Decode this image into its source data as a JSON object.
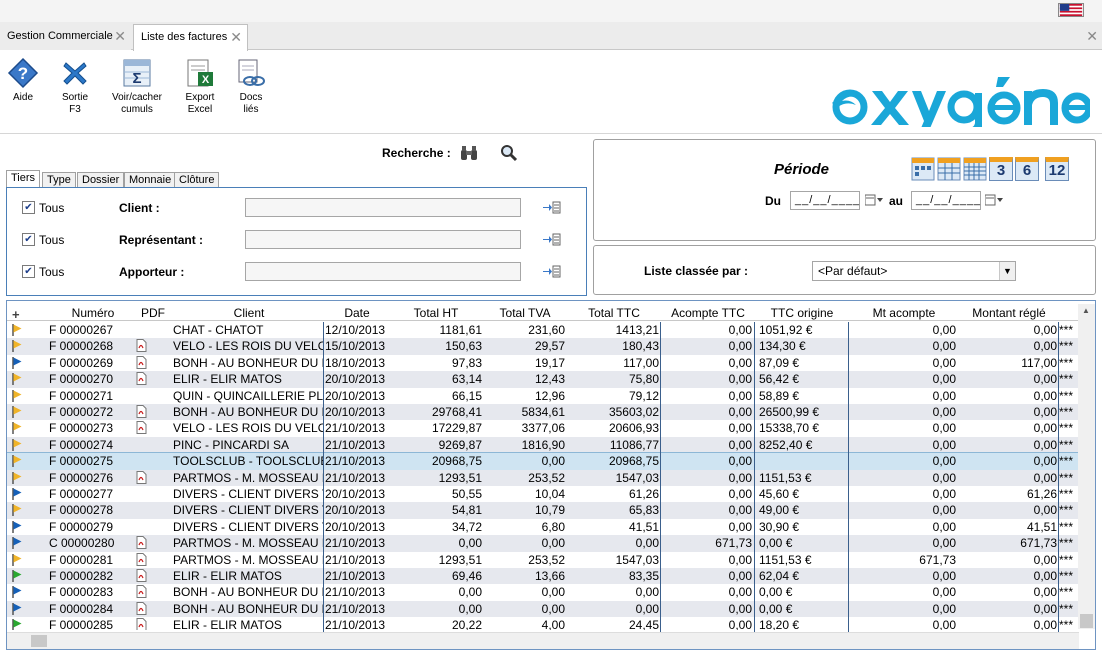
{
  "tabs": [
    {
      "label": "Gestion Commerciale"
    },
    {
      "label": "Liste des factures"
    }
  ],
  "toolbar": {
    "aide": "Aide",
    "sortie": "Sortie\nF3",
    "cumuls": "Voir/cacher\ncumuls",
    "export": "Export\nExcel",
    "docs": "Docs\nliés"
  },
  "search": {
    "label": "Recherche :"
  },
  "subtabs": [
    "Tiers",
    "Type",
    "Dossier",
    "Monnaie",
    "Clôture"
  ],
  "filters": [
    {
      "check": "Tous",
      "label": "Client :",
      "value": ""
    },
    {
      "check": "Tous",
      "label": "Représentant :",
      "value": ""
    },
    {
      "check": "Tous",
      "label": "Apporteur :",
      "value": ""
    }
  ],
  "periode": {
    "title": "Période",
    "du": "Du",
    "au": "au",
    "date_from": "__/__/____",
    "date_to": "__/__/____",
    "btn_3": "3",
    "btn_6": "6",
    "btn_12": "12"
  },
  "sort": {
    "label": "Liste classée par :",
    "value": "<Par défaut>"
  },
  "grid": {
    "headers": [
      "Numéro",
      "PDF",
      "Client",
      "Date",
      "Total HT",
      "Total TVA",
      "Total TTC",
      "Acompte TTC",
      "TTC origine",
      "Mt acompte",
      "Montant réglé"
    ],
    "rows": [
      {
        "flag": "orange",
        "pdf": false,
        "num": "F 00000267",
        "client": "CHAT - CHATOT",
        "date": "12/10/2013",
        "ht": "1181,61",
        "tva": "231,60",
        "ttc": "1413,21",
        "acompte": "0,00",
        "origine": "1051,92 €",
        "mt": "0,00",
        "regle": "0,00",
        "flagx": "***"
      },
      {
        "flag": "orange",
        "pdf": true,
        "num": "F 00000268",
        "client": "VELO - LES ROIS DU VELO",
        "date": "15/10/2013",
        "ht": "150,63",
        "tva": "29,57",
        "ttc": "180,43",
        "acompte": "0,00",
        "origine": "134,30 €",
        "mt": "0,00",
        "regle": "0,00",
        "flagx": "***"
      },
      {
        "flag": "blue",
        "pdf": true,
        "num": "F 00000269",
        "client": "BONH - AU BONHEUR DU B",
        "date": "18/10/2013",
        "ht": "97,83",
        "tva": "19,17",
        "ttc": "117,00",
        "acompte": "0,00",
        "origine": "87,09 €",
        "mt": "0,00",
        "regle": "117,00",
        "flagx": "***"
      },
      {
        "flag": "orange",
        "pdf": true,
        "num": "F 00000270",
        "client": "ELIR - ELIR MATOS",
        "date": "20/10/2013",
        "ht": "63,14",
        "tva": "12,43",
        "ttc": "75,80",
        "acompte": "0,00",
        "origine": "56,42 €",
        "mt": "0,00",
        "regle": "0,00",
        "flagx": "***"
      },
      {
        "flag": "orange",
        "pdf": false,
        "num": "F 00000271",
        "client": "QUIN - QUINCAILLERIE PL",
        "date": "20/10/2013",
        "ht": "66,15",
        "tva": "12,96",
        "ttc": "79,12",
        "acompte": "0,00",
        "origine": "58,89 €",
        "mt": "0,00",
        "regle": "0,00",
        "flagx": "***"
      },
      {
        "flag": "orange",
        "pdf": true,
        "num": "F 00000272",
        "client": "BONH - AU BONHEUR DU B",
        "date": "20/10/2013",
        "ht": "29768,41",
        "tva": "5834,61",
        "ttc": "35603,02",
        "acompte": "0,00",
        "origine": "26500,99 €",
        "mt": "0,00",
        "regle": "0,00",
        "flagx": "***"
      },
      {
        "flag": "orange",
        "pdf": true,
        "num": "F 00000273",
        "client": "VELO - LES ROIS DU VELO",
        "date": "21/10/2013",
        "ht": "17229,87",
        "tva": "3377,06",
        "ttc": "20606,93",
        "acompte": "0,00",
        "origine": "15338,70 €",
        "mt": "0,00",
        "regle": "0,00",
        "flagx": "***"
      },
      {
        "flag": "orange",
        "pdf": false,
        "num": "F 00000274",
        "client": "PINC - PINCARDI SA",
        "date": "21/10/2013",
        "ht": "9269,87",
        "tva": "1816,90",
        "ttc": "11086,77",
        "acompte": "0,00",
        "origine": "8252,40 €",
        "mt": "0,00",
        "regle": "0,00",
        "flagx": "***"
      },
      {
        "flag": "orange",
        "pdf": false,
        "num": "F 00000275",
        "client": "TOOLSCLUB - TOOLSCLUB",
        "date": "21/10/2013",
        "ht": "20968,75",
        "tva": "0,00",
        "ttc": "20968,75",
        "acompte": "0,00",
        "origine": "",
        "mt": "0,00",
        "regle": "0,00",
        "flagx": "***",
        "selected": true
      },
      {
        "flag": "orange",
        "pdf": true,
        "num": "F 00000276",
        "client": "PARTMOS - M. MOSSEAU E",
        "date": "21/10/2013",
        "ht": "1293,51",
        "tva": "253,52",
        "ttc": "1547,03",
        "acompte": "0,00",
        "origine": "1151,53 €",
        "mt": "0,00",
        "regle": "0,00",
        "flagx": "***"
      },
      {
        "flag": "blue",
        "pdf": false,
        "num": "F 00000277",
        "client": "DIVERS - CLIENT DIVERS T",
        "date": "20/10/2013",
        "ht": "50,55",
        "tva": "10,04",
        "ttc": "61,26",
        "acompte": "0,00",
        "origine": "45,60 €",
        "mt": "0,00",
        "regle": "61,26",
        "flagx": "***"
      },
      {
        "flag": "orange",
        "pdf": false,
        "num": "F 00000278",
        "client": "DIVERS - CLIENT DIVERS T",
        "date": "20/10/2013",
        "ht": "54,81",
        "tva": "10,79",
        "ttc": "65,83",
        "acompte": "0,00",
        "origine": "49,00 €",
        "mt": "0,00",
        "regle": "0,00",
        "flagx": "***"
      },
      {
        "flag": "blue",
        "pdf": false,
        "num": "F 00000279",
        "client": "DIVERS - CLIENT DIVERS T",
        "date": "20/10/2013",
        "ht": "34,72",
        "tva": "6,80",
        "ttc": "41,51",
        "acompte": "0,00",
        "origine": "30,90 €",
        "mt": "0,00",
        "regle": "41,51",
        "flagx": "***"
      },
      {
        "flag": "blue",
        "pdf": true,
        "num": "C 00000280",
        "client": "PARTMOS - M. MOSSEAU E",
        "date": "21/10/2013",
        "ht": "0,00",
        "tva": "0,00",
        "ttc": "0,00",
        "acompte": "671,73",
        "origine": "0,00 €",
        "mt": "0,00",
        "regle": "671,73",
        "flagx": "***"
      },
      {
        "flag": "orange",
        "pdf": true,
        "num": "F 00000281",
        "client": "PARTMOS - M. MOSSEAU E",
        "date": "21/10/2013",
        "ht": "1293,51",
        "tva": "253,52",
        "ttc": "1547,03",
        "acompte": "0,00",
        "origine": "1151,53 €",
        "mt": "671,73",
        "regle": "0,00",
        "flagx": "***"
      },
      {
        "flag": "green",
        "pdf": true,
        "num": "F 00000282",
        "client": "ELIR - ELIR MATOS",
        "date": "21/10/2013",
        "ht": "69,46",
        "tva": "13,66",
        "ttc": "83,35",
        "acompte": "0,00",
        "origine": "62,04 €",
        "mt": "0,00",
        "regle": "0,00",
        "flagx": "***"
      },
      {
        "flag": "blue",
        "pdf": true,
        "num": "F 00000283",
        "client": "BONH - AU BONHEUR DU B",
        "date": "21/10/2013",
        "ht": "0,00",
        "tva": "0,00",
        "ttc": "0,00",
        "acompte": "0,00",
        "origine": "0,00 €",
        "mt": "0,00",
        "regle": "0,00",
        "flagx": "***"
      },
      {
        "flag": "blue",
        "pdf": true,
        "num": "F 00000284",
        "client": "BONH - AU BONHEUR DU B",
        "date": "21/10/2013",
        "ht": "0,00",
        "tva": "0,00",
        "ttc": "0,00",
        "acompte": "0,00",
        "origine": "0,00 €",
        "mt": "0,00",
        "regle": "0,00",
        "flagx": "***"
      },
      {
        "flag": "green",
        "pdf": true,
        "num": "F 00000285",
        "client": "ELIR - ELIR MATOS",
        "date": "21/10/2013",
        "ht": "20,22",
        "tva": "4,00",
        "ttc": "24,45",
        "acompte": "0,00",
        "origine": "18,20 €",
        "mt": "0,00",
        "regle": "0,00",
        "flagx": "***"
      }
    ]
  },
  "colors": {
    "accent": "#4a7fb8",
    "logo": "#1aa7d8",
    "flag_orange": "#f0b429",
    "flag_blue": "#1560b8",
    "flag_green": "#2aa830",
    "selected": "#cfe4f2"
  }
}
